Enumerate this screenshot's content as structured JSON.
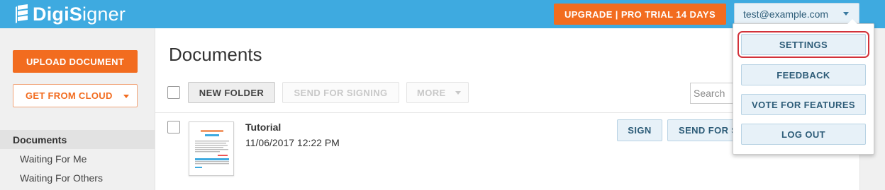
{
  "header": {
    "logo_bold": "DigiS",
    "logo_light": "igner",
    "upgrade_label": "UPGRADE | PRO TRIAL 14 DAYS",
    "user_email": "test@example.com"
  },
  "sidebar": {
    "upload_label": "UPLOAD DOCUMENT",
    "cloud_label": "GET FROM CLOUD",
    "items": [
      {
        "label": "Documents",
        "active": true
      },
      {
        "label": "Waiting For Me",
        "active": false
      },
      {
        "label": "Waiting For Others",
        "active": false
      }
    ]
  },
  "main": {
    "title": "Documents",
    "toolbar": {
      "new_folder": "NEW FOLDER",
      "send_for_signing": "SEND FOR SIGNING",
      "more": "MORE",
      "search_placeholder": "Search"
    },
    "document": {
      "name": "Tutorial",
      "date": "11/06/2017 12:22 PM",
      "thumb_title": "Getting Started with",
      "thumb_brand": "DigiSigner",
      "sign_label": "SIGN",
      "send_label": "SEND FOR SIGNING"
    }
  },
  "menu": {
    "items": [
      "SETTINGS",
      "FEEDBACK",
      "VOTE FOR FEATURES",
      "LOG OUT"
    ],
    "highlighted": "SETTINGS"
  },
  "colors": {
    "header": "#3eaae0",
    "accent": "#f26c1f",
    "button_blue": "#e7f1f8",
    "highlight": "#d2323a"
  }
}
